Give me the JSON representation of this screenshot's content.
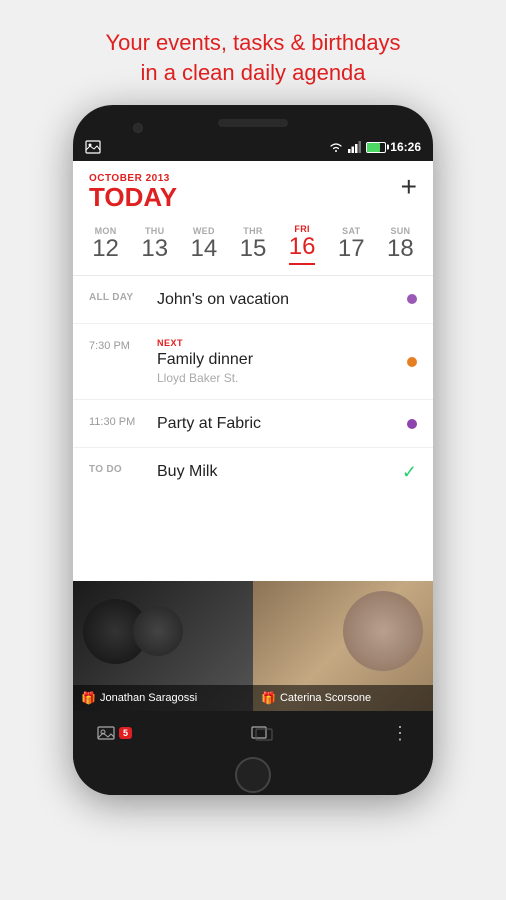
{
  "promo": {
    "line1": "Your events, tasks & birthdays",
    "line2": "in a clean daily agenda"
  },
  "statusBar": {
    "time": "16:26",
    "wifiIcon": "wifi",
    "signalIcon": "signal",
    "batteryIcon": "battery"
  },
  "header": {
    "monthYear": "OCTOBER 2013",
    "todayLabel": "TODAY",
    "addButton": "+"
  },
  "weekDays": [
    {
      "name": "MON",
      "num": "12",
      "active": false
    },
    {
      "name": "THU",
      "num": "13",
      "active": false
    },
    {
      "name": "WED",
      "num": "14",
      "active": false
    },
    {
      "name": "THR",
      "num": "15",
      "active": false
    },
    {
      "name": "FRI",
      "num": "16",
      "active": true
    },
    {
      "name": "SAT",
      "num": "17",
      "active": false
    },
    {
      "name": "SUN",
      "num": "18",
      "active": false
    }
  ],
  "events": [
    {
      "type": "allday",
      "timeLabel": "ALL DAY",
      "badge": "",
      "title": "John's on vacation",
      "subtitle": "",
      "dotColor": "purple"
    },
    {
      "type": "timed",
      "timeLabel": "7:30 PM",
      "badge": "NEXT",
      "title": "Family dinner",
      "subtitle": "Lloyd Baker St.",
      "dotColor": "orange"
    },
    {
      "type": "timed",
      "timeLabel": "11:30 PM",
      "badge": "",
      "title": "Party at Fabric",
      "subtitle": "",
      "dotColor": "purple"
    },
    {
      "type": "todo",
      "timeLabel": "TO DO",
      "badge": "",
      "title": "Buy Milk",
      "subtitle": "",
      "checked": true
    }
  ],
  "birthdays": [
    {
      "name": "Jonathan Saragossi"
    },
    {
      "name": "Caterina Scorsone"
    }
  ],
  "bottomBar": {
    "photoCount": "5",
    "moreIcon": "⋮"
  }
}
